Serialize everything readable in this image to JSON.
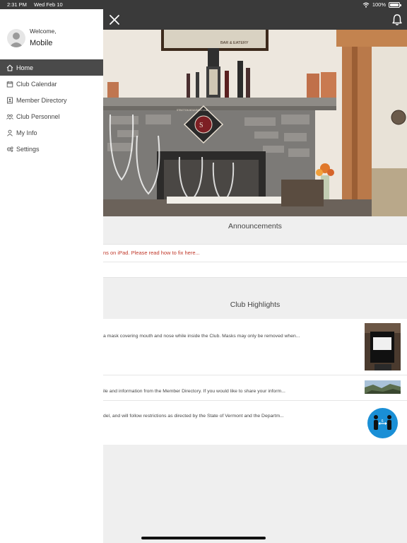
{
  "status_bar": {
    "time": "2:31 PM",
    "date": "Wed Feb 10",
    "battery": "100%"
  },
  "drawer": {
    "welcome": "Welcome,",
    "user_name": "Mobile",
    "items": [
      {
        "label": "Home",
        "icon": "home-icon",
        "active": true
      },
      {
        "label": "Club Calendar",
        "icon": "calendar-icon"
      },
      {
        "label": "Member Directory",
        "icon": "directory-icon"
      },
      {
        "label": "Club Personnel",
        "icon": "people-icon"
      },
      {
        "label": "My Info",
        "icon": "person-icon"
      },
      {
        "label": "Settings",
        "icon": "gear-icon"
      }
    ]
  },
  "hero": {
    "sign_text": "BAR & EATERY",
    "logo_text": "STRATTON MOUNTAIN CLUB"
  },
  "announcements": {
    "title": "Announcements",
    "items": [
      {
        "text": "ns on iPad. Please read how to fix here..."
      }
    ]
  },
  "highlights": {
    "title": "Club Highlights",
    "items": [
      {
        "text": "a mask covering mouth and nose while inside the Club. Masks may only be removed when..."
      },
      {
        "text": "ile and information from the Member Directory. If you would like to share your inform..."
      },
      {
        "text": "del, and will follow restrictions as directed by the State of Vermont and the Departm..."
      }
    ]
  },
  "colors": {
    "header": "#3a3a3a",
    "active_item": "#4a4a4a",
    "announcement_link": "#c0392b",
    "badge_blue": "#1a8fd6"
  }
}
